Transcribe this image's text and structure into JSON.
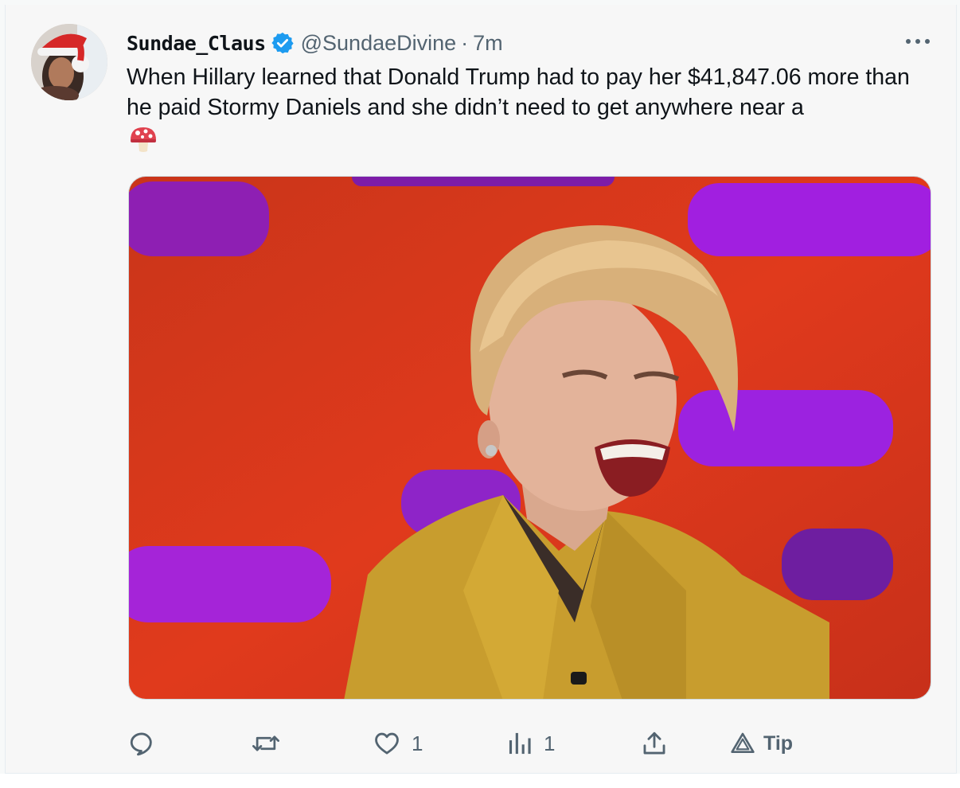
{
  "tweet": {
    "display_name": "Sundae_Claus",
    "handle": "@SundaeDivine",
    "separator": "·",
    "time": "7m",
    "text": "When Hillary learned that Donald Trump had to pay her $41,847.06 more than he paid Stormy Daniels and she didn’t need to get anywhere near a",
    "emoji": "mushroom-emoji",
    "verified": true
  },
  "actions": {
    "reply_icon": "reply-icon",
    "retweet_icon": "retweet-icon",
    "like_icon": "heart-icon",
    "like_count": "1",
    "views_icon": "analytics-icon",
    "views_count": "1",
    "share_icon": "share-icon",
    "tip_icon": "tip-icon",
    "tip_label": "Tip"
  },
  "colors": {
    "verified_blue": "#1d9bf0",
    "muted_text": "#536471",
    "text": "#0f1419",
    "media_background": "#d8341a",
    "media_stripes": "#a224d8",
    "jacket": "#caa033"
  }
}
